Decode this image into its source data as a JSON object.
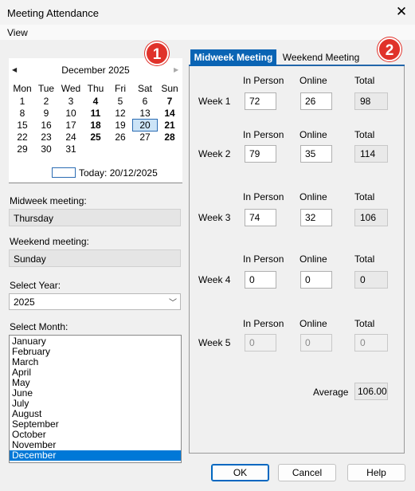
{
  "window": {
    "title": "Meeting Attendance"
  },
  "menu": {
    "view": "View"
  },
  "calendar": {
    "month_label": "December 2025",
    "day_headers": [
      "Mon",
      "Tue",
      "Wed",
      "Thu",
      "Fri",
      "Sat",
      "Sun"
    ],
    "weeks": [
      [
        "1",
        "2",
        "3",
        "4",
        "5",
        "6",
        "7"
      ],
      [
        "8",
        "9",
        "10",
        "11",
        "12",
        "13",
        "14"
      ],
      [
        "15",
        "16",
        "17",
        "18",
        "19",
        "20",
        "21"
      ],
      [
        "22",
        "23",
        "24",
        "25",
        "26",
        "27",
        "28"
      ],
      [
        "29",
        "30",
        "31",
        "",
        "",
        "",
        ""
      ]
    ],
    "bold_days": [
      "4",
      "7",
      "11",
      "14",
      "18",
      "21",
      "25",
      "28"
    ],
    "selected_day": "20",
    "today_text": "Today: 20/12/2025"
  },
  "badges": {
    "left": "1",
    "right": "2"
  },
  "left": {
    "midweek_label": "Midweek meeting:",
    "midweek_value": "Thursday",
    "weekend_label": "Weekend meeting:",
    "weekend_value": "Sunday",
    "year_label": "Select Year:",
    "year_value": "2025",
    "month_label": "Select Month:",
    "months": [
      "January",
      "February",
      "March",
      "April",
      "May",
      "June",
      "July",
      "August",
      "September",
      "October",
      "November",
      "December"
    ],
    "selected_month": "December"
  },
  "tabs": {
    "midweek": "Midweek Meeting",
    "weekend": "Weekend Meeting"
  },
  "columns": {
    "in_person": "In Person",
    "online": "Online",
    "total": "Total"
  },
  "weeks": [
    {
      "label": "Week 1",
      "in_person": "72",
      "online": "26",
      "total": "98",
      "enabled": true
    },
    {
      "label": "Week 2",
      "in_person": "79",
      "online": "35",
      "total": "114",
      "enabled": true
    },
    {
      "label": "Week 3",
      "in_person": "74",
      "online": "32",
      "total": "106",
      "enabled": true
    },
    {
      "label": "Week 4",
      "in_person": "0",
      "online": "0",
      "total": "0",
      "enabled": true
    },
    {
      "label": "Week 5",
      "in_person": "0",
      "online": "0",
      "total": "0",
      "enabled": false
    }
  ],
  "average": {
    "label": "Average",
    "value": "106.00"
  },
  "buttons": {
    "ok": "OK",
    "cancel": "Cancel",
    "help": "Help"
  },
  "colors": {
    "accent": "#0a64b4",
    "selection": "#0078d7",
    "badge": "#e0322a"
  }
}
